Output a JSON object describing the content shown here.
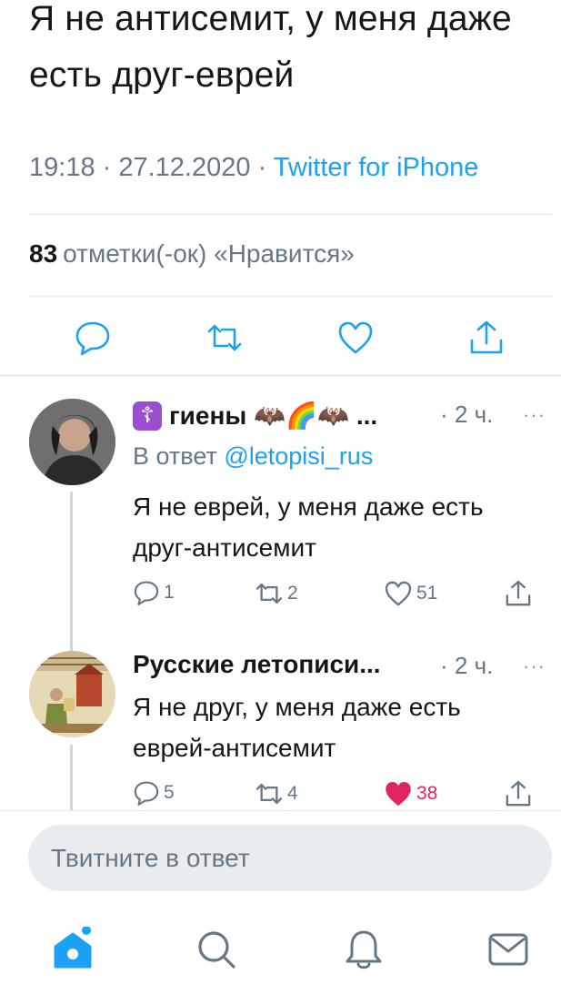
{
  "main_tweet": {
    "text": "Я не антисемит, у меня даже есть друг-еврей",
    "time": "19:18",
    "date": "27.12.2020",
    "source": "Twitter for iPhone",
    "likes_count": "83",
    "likes_label": "отметки(-ок) «Нравится»"
  },
  "replies": [
    {
      "name": "гиены",
      "name_emojis": "☦ 🦇🌈🦇",
      "name_ellipsis": "...",
      "time": "· 2 ч.",
      "more": "···",
      "reply_to_prefix": "В ответ",
      "reply_to_handle": "@letopisi_rus",
      "text": "Я не еврей, у меня даже есть друг-антисемит",
      "reply_count": "1",
      "retweet_count": "2",
      "like_count": "51",
      "liked": false
    },
    {
      "name": "Русские летописи...",
      "time": "· 2 ч.",
      "more": "···",
      "text": "Я не друг, у меня даже есть еврей-антисемит",
      "reply_count": "5",
      "retweet_count": "4",
      "like_count": "38",
      "liked": true
    }
  ],
  "compose": {
    "placeholder": "Твитните в ответ"
  },
  "tabs": [
    "home-icon",
    "search-icon",
    "notifications-icon",
    "messages-icon"
  ],
  "colors": {
    "accent": "#1da1f2",
    "like": "#e0245e",
    "muted": "#657786"
  }
}
